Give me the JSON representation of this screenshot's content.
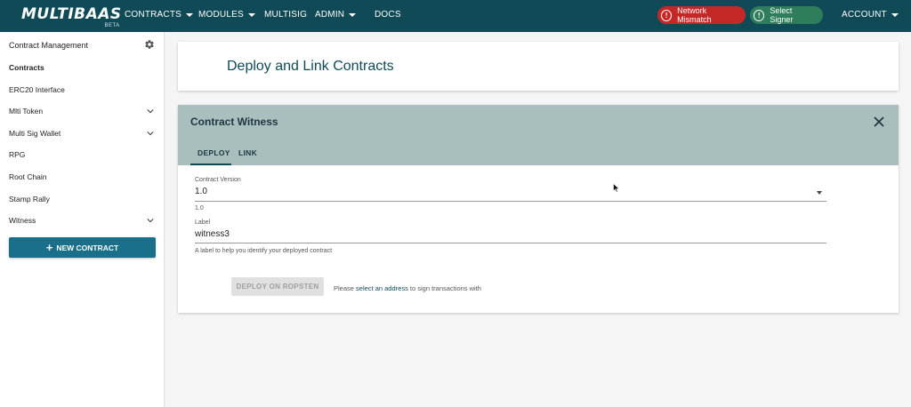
{
  "brand": {
    "name": "MULTIBAAS",
    "beta": "BETA"
  },
  "nav": {
    "contracts": "CONTRACTS",
    "modules": "MODULES",
    "multisig": "MULTISIG",
    "admin": "ADMIN",
    "docs": "DOCS",
    "network_mismatch": "Network Mismatch",
    "select_signer": "Select Signer",
    "account": "ACCOUNT",
    "alert_glyph": "!"
  },
  "sidebar": {
    "header": "Contract Management",
    "items": [
      {
        "label": "Contracts",
        "active": true,
        "expandable": false
      },
      {
        "label": "ERC20 Interface",
        "active": false,
        "expandable": false
      },
      {
        "label": "Mlti Token",
        "active": false,
        "expandable": true
      },
      {
        "label": "Multi Sig Wallet",
        "active": false,
        "expandable": true
      },
      {
        "label": "RPG",
        "active": false,
        "expandable": false
      },
      {
        "label": "Root Chain",
        "active": false,
        "expandable": false
      },
      {
        "label": "Stamp Rally",
        "active": false,
        "expandable": false
      },
      {
        "label": "Witness",
        "active": false,
        "expandable": true
      }
    ],
    "new_contract": "NEW CONTRACT"
  },
  "main": {
    "page_title": "Deploy and Link Contracts",
    "panel": {
      "title": "Contract Witness",
      "tabs": [
        {
          "label": "DEPLOY",
          "selected": true
        },
        {
          "label": "LINK",
          "selected": false
        }
      ],
      "version": {
        "label": "Contract Version",
        "value": "1.0",
        "helper": "1.0"
      },
      "name": {
        "label": "Label",
        "value": "witness3",
        "helper": "A label to help you identify your deployed contract"
      },
      "deploy_button": "DEPLOY ON ROPSTEN",
      "sign_prefix": "Please ",
      "sign_link": "select an address",
      "sign_suffix": " to sign transactions with"
    }
  },
  "colors": {
    "topbar": "#0f4a56",
    "accent": "#1a6f8a",
    "panel_header": "#a8bfbd",
    "danger": "#c62828",
    "success": "#2e7d5b"
  }
}
